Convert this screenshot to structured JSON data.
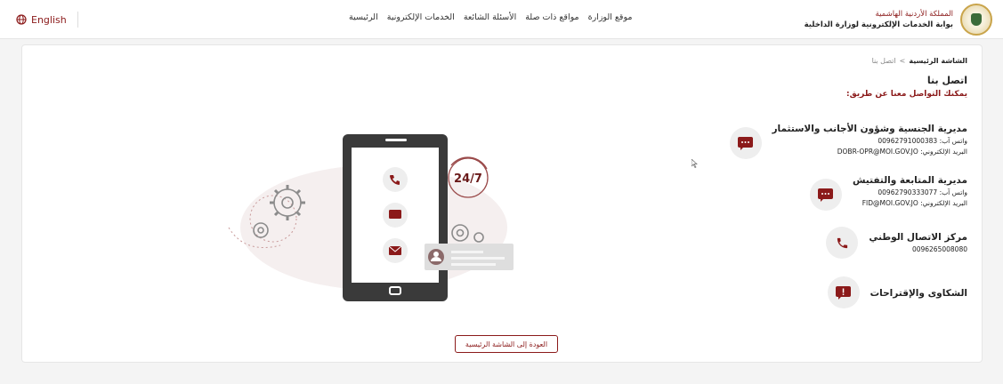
{
  "header": {
    "language_label": "English",
    "nav": [
      "الرئيسية",
      "الخدمات الإلكترونية",
      "الأسئلة الشائعة",
      "مواقع ذات صلة",
      "موقع الوزارة"
    ],
    "brand_line1": "المملكة الأردنية الهاشمية",
    "brand_line2": "بوابة الخدمات الإلكترونية لوزارة الداخلية"
  },
  "breadcrumb": {
    "home": "الشاشة الرئيسية",
    "separator": ">",
    "current": "اتصل بنا"
  },
  "page": {
    "title": "اتصل بنا",
    "subtitle": "يمكنك التواصل معنا عن طريق:"
  },
  "contacts": [
    {
      "title": "مديرية الجنسية وشؤون الأجانب والاستثمار",
      "whatsapp": "واتس آب: 00962791000383",
      "email": "البريد الإلكتروني: DOBR-OPR@MOI.GOV.JO",
      "icon": "chat-icon"
    },
    {
      "title": "مديرية المتابعة والتفتيش",
      "whatsapp": "واتس آب: 00962790333077",
      "email": "البريد الإلكتروني: FID@MOI.GOV.JO",
      "icon": "chat-icon"
    },
    {
      "title": "مركز الاتصال الوطني",
      "phone": "0096265008080",
      "icon": "phone-icon"
    },
    {
      "title": "الشكاوى والإقتراحات",
      "icon": "alert-message-icon"
    }
  ],
  "illustration": {
    "badge": "24/7"
  },
  "back_button": "العودة إلى الشاشة الرئيسية",
  "colors": {
    "accent": "#8b1a1a",
    "icon_bg": "#eeeeee",
    "phone_frame": "#3a3a3a"
  }
}
